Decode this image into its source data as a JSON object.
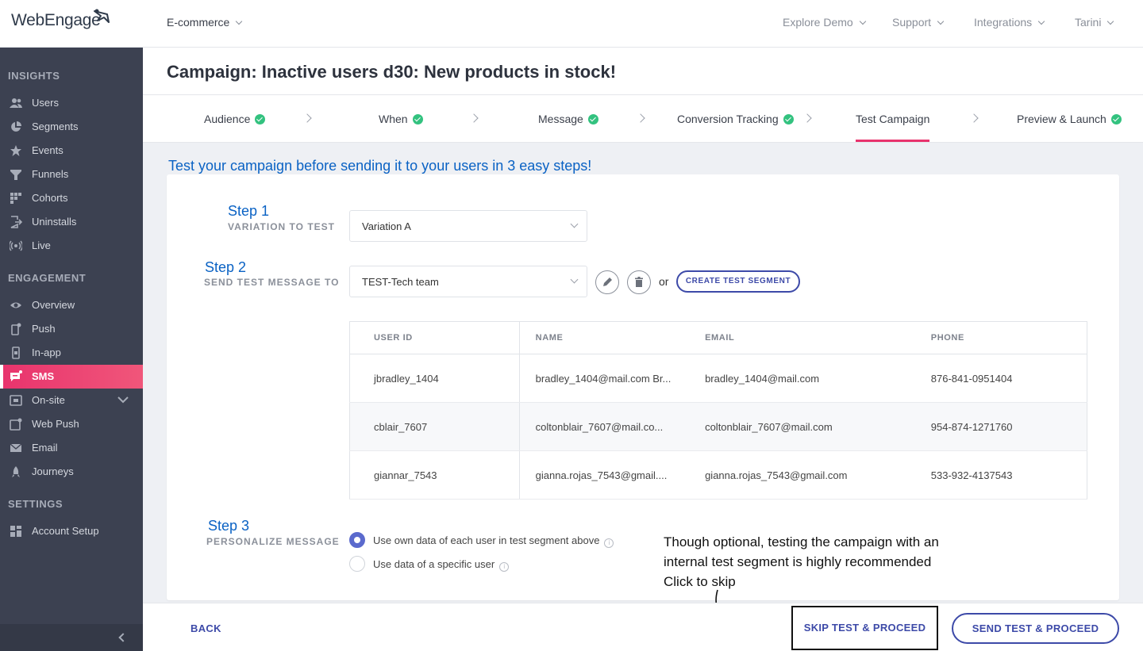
{
  "brand": {
    "name": "WebEngage",
    "accent": "#e8336d",
    "link_color": "#3d4aa8",
    "step_color": "#0a62c4"
  },
  "topbar": {
    "project": "E-commerce",
    "nav": [
      "Explore Demo",
      "Support",
      "Integrations",
      "Tarini"
    ]
  },
  "sidebar": {
    "sections": [
      {
        "title": "INSIGHTS",
        "items": [
          {
            "label": "Users",
            "icon": "users-icon"
          },
          {
            "label": "Segments",
            "icon": "pie-icon"
          },
          {
            "label": "Events",
            "icon": "star-icon"
          },
          {
            "label": "Funnels",
            "icon": "funnel-icon"
          },
          {
            "label": "Cohorts",
            "icon": "grid-icon"
          },
          {
            "label": "Uninstalls",
            "icon": "exit-icon"
          },
          {
            "label": "Live",
            "icon": "broadcast-icon"
          }
        ]
      },
      {
        "title": "ENGAGEMENT",
        "items": [
          {
            "label": "Overview",
            "icon": "eye-icon"
          },
          {
            "label": "Push",
            "icon": "mobile-push-icon"
          },
          {
            "label": "In-app",
            "icon": "mobile-icon"
          },
          {
            "label": "SMS",
            "icon": "sms-icon",
            "active": true
          },
          {
            "label": "On-site",
            "icon": "onsite-icon"
          },
          {
            "label": "Web Push",
            "icon": "webpush-icon"
          },
          {
            "label": "Email",
            "icon": "email-icon"
          },
          {
            "label": "Journeys",
            "icon": "rocket-icon"
          }
        ]
      },
      {
        "title": "SETTINGS",
        "items": [
          {
            "label": "Account Setup",
            "icon": "setup-icon"
          }
        ]
      }
    ]
  },
  "page": {
    "title": "Campaign: Inactive users d30: New products in stock!"
  },
  "steps": [
    {
      "label": "Audience",
      "done": true
    },
    {
      "label": "When",
      "done": true
    },
    {
      "label": "Message",
      "done": true
    },
    {
      "label": "Conversion Tracking",
      "done": true
    },
    {
      "label": "Test Campaign",
      "done": false,
      "active": true
    },
    {
      "label": "Preview & Launch",
      "done": true
    }
  ],
  "intro": "Test your campaign before sending it to your users in 3 easy steps!",
  "step1": {
    "num": "Step 1",
    "desc": "VARIATION TO TEST",
    "value": "Variation A"
  },
  "step2": {
    "num": "Step 2",
    "desc": "SEND TEST MESSAGE TO",
    "value": "TEST-Tech team",
    "or": "or",
    "create_label": "CREATE TEST SEGMENT"
  },
  "table": {
    "headers": [
      "USER ID",
      "NAME",
      "EMAIL",
      "PHONE"
    ],
    "rows": [
      [
        "jbradley_1404",
        "bradley_1404@mail.com Br...",
        "bradley_1404@mail.com",
        "876-841-0951404"
      ],
      [
        "cblair_7607",
        "coltonblair_7607@mail.co...",
        "coltonblair_7607@mail.com",
        "954-874-1271760"
      ],
      [
        "giannar_7543",
        "gianna.rojas_7543@gmail....",
        "gianna.rojas_7543@gmail.com",
        "533-932-4137543"
      ]
    ]
  },
  "step3": {
    "num": "Step 3",
    "desc": "PERSONALIZE MESSAGE",
    "opt1": "Use own data of each user in test segment above",
    "opt2": "Use data of a specific user",
    "info": "i"
  },
  "annotation": {
    "line1": "Though optional, testing the campaign with an",
    "line2": "internal test segment is highly recommended",
    "line3": "Click to skip"
  },
  "footer": {
    "back": "BACK",
    "skip": "SKIP TEST & PROCEED",
    "send": "SEND TEST & PROCEED"
  }
}
